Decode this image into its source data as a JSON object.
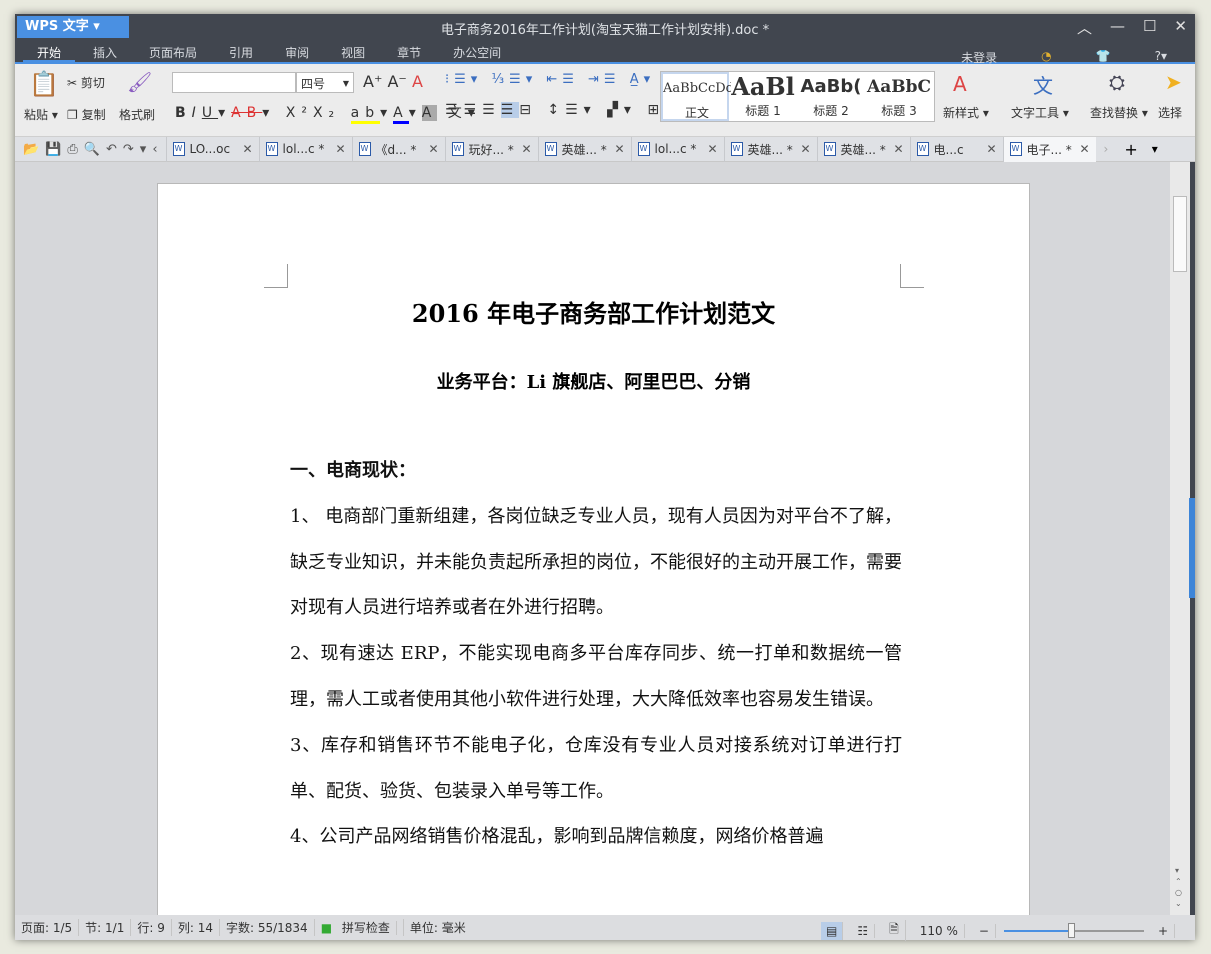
{
  "app": {
    "name": "WPS 文字",
    "title": "电子商务2016年工作计划(淘宝天猫工作计划安排).doc *",
    "login": "未登录"
  },
  "menu": [
    "开始",
    "插入",
    "页面布局",
    "引用",
    "审阅",
    "视图",
    "章节",
    "办公空间"
  ],
  "ribbon": {
    "paste": "粘贴",
    "cut": "剪切",
    "copy": "复制",
    "format_painter": "格式刷",
    "font_name": "",
    "font_size": "四号",
    "styles": [
      {
        "sample": "AaBbCcDd",
        "label": "正文"
      },
      {
        "sample": "AaBl",
        "label": "标题 1"
      },
      {
        "sample": "AaBb(",
        "label": "标题 2"
      },
      {
        "sample": "AaBbC",
        "label": "标题 3"
      }
    ],
    "new_style": "新样式",
    "text_tools": "文字工具",
    "find_replace": "查找替换",
    "select": "选择"
  },
  "tabs": [
    {
      "label": "LO...oc",
      "close": "✕"
    },
    {
      "label": "lol...c *",
      "close": "✕"
    },
    {
      "label": "《d... *",
      "close": "✕"
    },
    {
      "label": "玩好... *",
      "close": "✕"
    },
    {
      "label": "英雄... *",
      "close": "✕"
    },
    {
      "label": "lol...c *",
      "close": "✕"
    },
    {
      "label": "英雄... *",
      "close": "✕"
    },
    {
      "label": "英雄... *",
      "close": "✕"
    },
    {
      "label": "电...c",
      "close": "✕"
    },
    {
      "label": "电子... *",
      "close": "✕",
      "active": true
    }
  ],
  "document": {
    "title": "2016 年电子商务部工作计划范文",
    "subtitle": "业务平台：Li 旗舰店、阿里巴巴、分销",
    "heading1": "一、电商现状：",
    "paragraphs": [
      "1、 电商部门重新组建，各岗位缺乏专业人员，现有人员因为对平台不了解，缺乏专业知识，并未能负责起所承担的岗位，不能很好的主动开展工作，需要对现有人员进行培养或者在外进行招聘。",
      "2、现有速达 ERP，不能实现电商多平台库存同步、统一打单和数据统一管理，需人工或者使用其他小软件进行处理，大大降低效率也容易发生错误。",
      "3、库存和销售环节不能电子化，仓库没有专业人员对接系统对订单进行打单、配货、验货、包装录入单号等工作。",
      "4、公司产品网络销售价格混乱，影响到品牌信赖度，网络价格普遍"
    ]
  },
  "status": {
    "page": "页面: 1/5",
    "section": "节: 1/1",
    "row": "行: 9",
    "col": "列: 14",
    "words": "字数: 55/1834",
    "spell": "拼写检查",
    "unit": "单位: 毫米",
    "zoom": "110 %",
    "zoom_percent": 110
  },
  "colors": {
    "titlebar": "#41464f",
    "accent": "#4a90e2",
    "ribbon": "#ececec"
  }
}
